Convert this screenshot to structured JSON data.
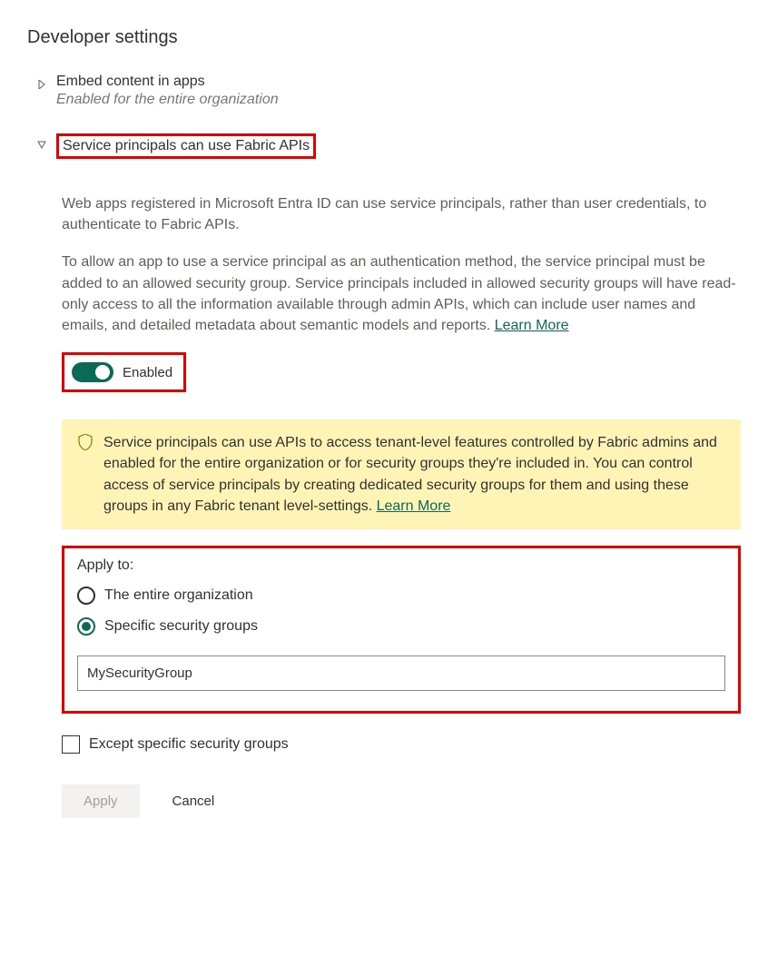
{
  "section_title": "Developer settings",
  "settings": {
    "embed": {
      "title": "Embed content in apps",
      "subtitle": "Enabled for the entire organization"
    },
    "service_principals": {
      "title": "Service principals can use Fabric APIs",
      "para1": "Web apps registered in Microsoft Entra ID can use service principals, rather than user credentials, to authenticate to Fabric APIs.",
      "para2_prefix": "To allow an app to use a service principal as an authentication method, the service principal must be added to an allowed security group. Service principals included in allowed security groups will have read-only access to all the information available through admin APIs, which can include user names and emails, and detailed metadata about semantic models and reports.  ",
      "learn_more": "Learn More",
      "toggle_label": "Enabled",
      "banner_text_prefix": "Service principals can use APIs to access tenant-level features controlled by Fabric admins and enabled for the entire organization or for security groups they're included in. You can control access of service principals by creating dedicated security groups for them and using these groups in any Fabric tenant level-settings.  ",
      "banner_learn_more": "Learn More",
      "apply_label": "Apply to:",
      "radio_entire": "The entire organization",
      "radio_specific": "Specific security groups",
      "group_value": "MySecurityGroup",
      "except_label": "Except specific security groups",
      "apply_button": "Apply",
      "cancel_button": "Cancel"
    }
  }
}
